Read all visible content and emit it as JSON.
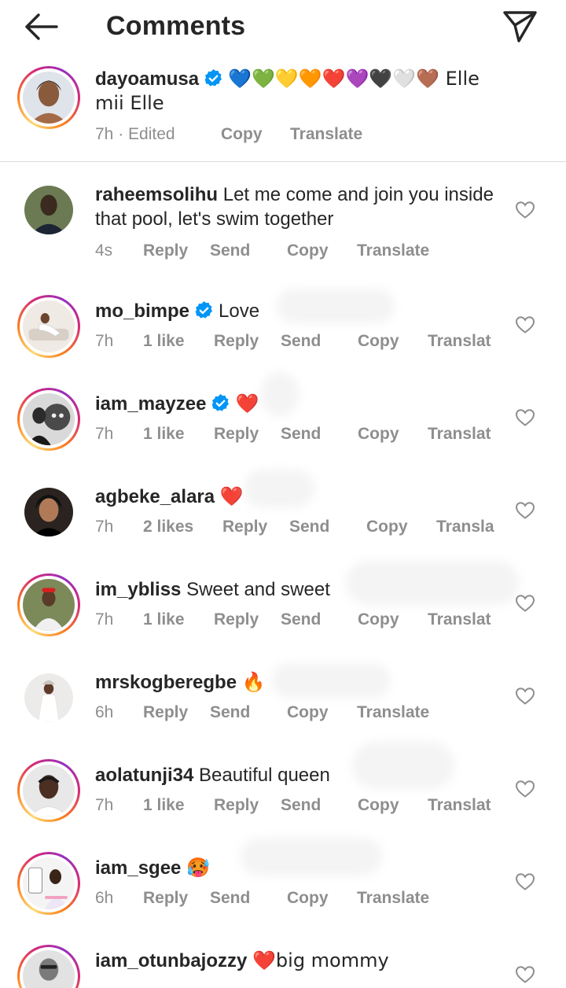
{
  "header": {
    "title": "Comments",
    "back_icon": "arrow-left-icon",
    "share_icon": "paper-plane-icon"
  },
  "caption": {
    "username": "dayoamusa",
    "verified": true,
    "text": "💙💚💛🧡❤️💜🖤🤍🤎 Elle mii Elle",
    "time": "7h · Edited",
    "copy": "Copy",
    "translate": "Translate"
  },
  "comments": [
    {
      "username": "raheemsolihu",
      "verified": false,
      "text": "Let me come and join you inside that pool, let's swim together",
      "time": "4s",
      "likes": "",
      "reply": "Reply",
      "send": "Send",
      "copy": "Copy",
      "translate": "Translate"
    },
    {
      "username": "mo_bimpe",
      "verified": true,
      "text": "Love",
      "time": "7h",
      "likes": "1 like",
      "reply": "Reply",
      "send": "Send",
      "copy": "Copy",
      "translate": "Translat"
    },
    {
      "username": "iam_mayzee",
      "verified": true,
      "text": "❤️",
      "time": "7h",
      "likes": "1 like",
      "reply": "Reply",
      "send": "Send",
      "copy": "Copy",
      "translate": "Translat"
    },
    {
      "username": "agbeke_alara",
      "verified": false,
      "text": "❤️",
      "time": "7h",
      "likes": "2 likes",
      "reply": "Reply",
      "send": "Send",
      "copy": "Copy",
      "translate": "Transla"
    },
    {
      "username": "im_ybliss",
      "verified": false,
      "text": "Sweet and sweet",
      "time": "7h",
      "likes": "1 like",
      "reply": "Reply",
      "send": "Send",
      "copy": "Copy",
      "translate": "Translat"
    },
    {
      "username": "mrskogberegbe",
      "verified": false,
      "text": "🔥",
      "time": "6h",
      "likes": "",
      "reply": "Reply",
      "send": "Send",
      "copy": "Copy",
      "translate": "Translate"
    },
    {
      "username": "aolatunji34",
      "verified": false,
      "text": "Beautiful queen",
      "time": "7h",
      "likes": "1 like",
      "reply": "Reply",
      "send": "Send",
      "copy": "Copy",
      "translate": "Translat"
    },
    {
      "username": "iam_sgee",
      "verified": false,
      "text": "🥵",
      "time": "6h",
      "likes": "",
      "reply": "Reply",
      "send": "Send",
      "copy": "Copy",
      "translate": "Translate"
    },
    {
      "username": "iam_otunbajozzy",
      "verified": false,
      "text": "❤️big mommy",
      "time": "",
      "likes": "",
      "reply": "",
      "send": "",
      "copy": "",
      "translate": ""
    }
  ],
  "colors": {
    "text": "#262626",
    "secondary": "#8e8e8e",
    "verified": "#0095f6",
    "divider": "#dbdbdb"
  }
}
